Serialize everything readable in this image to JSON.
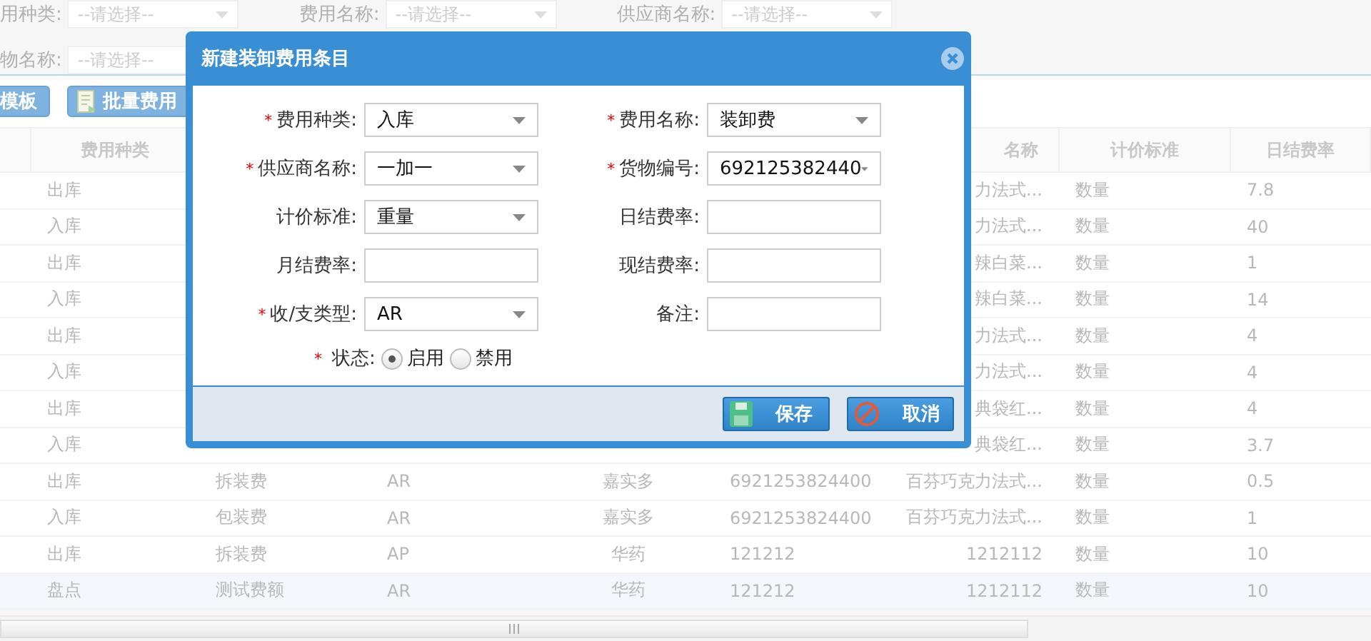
{
  "filters": [
    {
      "label": "用种类:",
      "placeholder": "--请选择--"
    },
    {
      "label": "费用名称:",
      "placeholder": "--请选择--"
    },
    {
      "label": "供应商名称:",
      "placeholder": "--请选择--"
    },
    {
      "label": "物名称:",
      "placeholder": "--请选择--"
    }
  ],
  "toolbar": [
    {
      "label": "模板"
    },
    {
      "label": "批量费用"
    }
  ],
  "table": {
    "columns": [
      {
        "label": "费用种类"
      },
      {},
      {},
      {},
      {},
      {
        "label": "名称"
      },
      {
        "label": "计价标准"
      },
      {
        "label": "日结费率"
      }
    ],
    "rows": [
      {
        "selected": false,
        "cells": [
          "出库",
          null,
          null,
          null,
          null,
          "力法式...",
          "数量",
          "7.8"
        ]
      },
      {
        "selected": false,
        "cells": [
          "入库",
          null,
          null,
          null,
          null,
          "力法式...",
          "数量",
          "40"
        ]
      },
      {
        "selected": false,
        "cells": [
          "出库",
          null,
          null,
          null,
          null,
          "辣白菜...",
          "数量",
          "1"
        ]
      },
      {
        "selected": false,
        "cells": [
          "入库",
          null,
          null,
          null,
          null,
          "辣白菜...",
          "数量",
          "14"
        ]
      },
      {
        "selected": false,
        "cells": [
          "出库",
          null,
          null,
          null,
          null,
          "力法式...",
          "数量",
          "4"
        ]
      },
      {
        "selected": false,
        "cells": [
          "入库",
          null,
          null,
          null,
          null,
          "力法式...",
          "数量",
          "4"
        ]
      },
      {
        "selected": false,
        "cells": [
          "出库",
          null,
          null,
          null,
          null,
          "典袋红...",
          "数量",
          "4"
        ]
      },
      {
        "selected": false,
        "cells": [
          "入库",
          null,
          null,
          null,
          null,
          "典袋红...",
          "数量",
          "3.7"
        ]
      },
      {
        "selected": false,
        "cells": [
          "出库",
          "拆装费",
          "AR",
          "嘉实多",
          "6921253824400",
          "百芬巧克力法式...",
          "数量",
          "0.5"
        ]
      },
      {
        "selected": false,
        "cells": [
          "入库",
          "包装费",
          "AR",
          "嘉实多",
          "6921253824400",
          "百芬巧克力法式...",
          "数量",
          "1"
        ]
      },
      {
        "selected": false,
        "cells": [
          "出库",
          "拆装费",
          "AP",
          "华药",
          "121212",
          "1212112",
          "数量",
          "10"
        ]
      },
      {
        "selected": true,
        "cells": [
          "盘点",
          "测试费额",
          "AR",
          "华药",
          "121212",
          "1212112",
          "数量",
          "10"
        ]
      }
    ]
  },
  "dialog": {
    "title": "新建装卸费用条目",
    "fields": [
      {
        "kind": "select",
        "marker": "*",
        "label": "费用种类:",
        "value": "入库"
      },
      {
        "kind": "select",
        "marker": "*",
        "label": "费用名称:",
        "value": "装卸费"
      },
      {
        "kind": "select",
        "marker": "*",
        "label": "供应商名称:",
        "value": "一加一"
      },
      {
        "kind": "select",
        "marker": "*",
        "label": "货物编号:",
        "value": "692125382440"
      },
      {
        "kind": "select",
        "label": "计价标准:",
        "value": "重量"
      },
      {
        "kind": "text",
        "label": "日结费率:"
      },
      {
        "kind": "text",
        "label": "月结费率:"
      },
      {
        "kind": "text",
        "label": "现结费率:"
      },
      {
        "kind": "select",
        "marker": "*",
        "label": "收/支类型:",
        "value": "AR"
      },
      {
        "kind": "text",
        "label": "备注:"
      },
      {
        "kind": "radio",
        "marker": "*",
        "label": "状态:",
        "options": [
          {
            "label": "启用",
            "selected": true
          },
          {
            "label": "禁用",
            "selected": false
          }
        ]
      }
    ],
    "buttons": [
      {
        "label": "保存"
      },
      {
        "label": "取消"
      }
    ]
  }
}
